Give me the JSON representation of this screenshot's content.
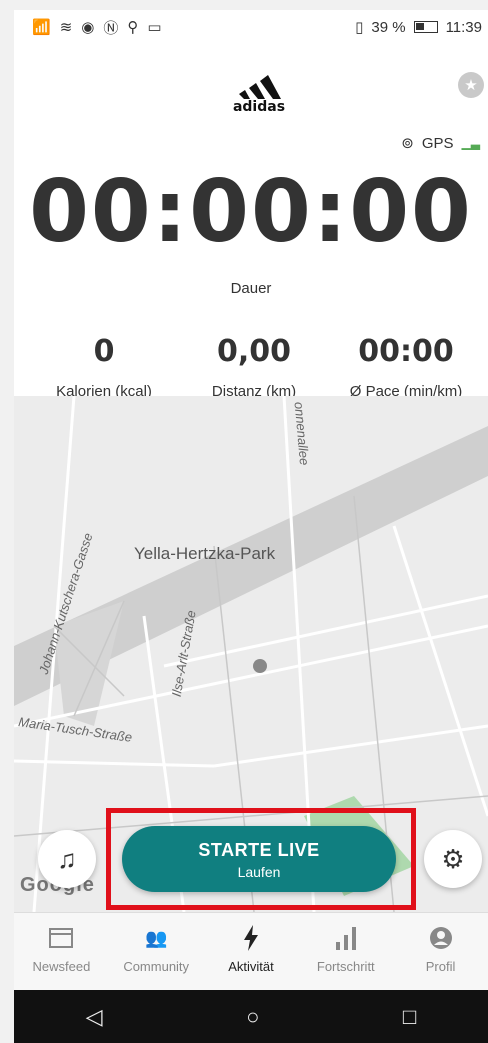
{
  "status_bar": {
    "left_icons": "📶 ≋ ◉ Ⓝ ⚲ ▭",
    "battery_percent": "39 %",
    "time": "11:39"
  },
  "header": {
    "brand": "adidas",
    "gps_label": "GPS"
  },
  "timer": {
    "value": "00:00:00",
    "label": "Dauer"
  },
  "stats": [
    {
      "value": "0",
      "label": "Kalorien (kcal)"
    },
    {
      "value": "0,00",
      "label": "Distanz (km)"
    },
    {
      "value": "00:00",
      "label": "Ø Pace (min/km)"
    }
  ],
  "map": {
    "park_label": "Yella-Hertzka-Park",
    "streets": [
      "Johann-Kutschera-Gasse",
      "Ilse-Arlt-Straße",
      "Maria-Tusch-Straße",
      "onnenallee"
    ],
    "attribution": "Google"
  },
  "start_button": {
    "title": "STARTE LIVE",
    "subtitle": "Laufen",
    "color": "#107f80"
  },
  "tabs": [
    {
      "label": "Newsfeed",
      "icon": "newsfeed-icon",
      "active": false
    },
    {
      "label": "Community",
      "icon": "community-icon",
      "active": false
    },
    {
      "label": "Aktivität",
      "icon": "activity-icon",
      "active": true
    },
    {
      "label": "Fortschritt",
      "icon": "progress-icon",
      "active": false
    },
    {
      "label": "Profil",
      "icon": "profile-icon",
      "active": false
    }
  ]
}
